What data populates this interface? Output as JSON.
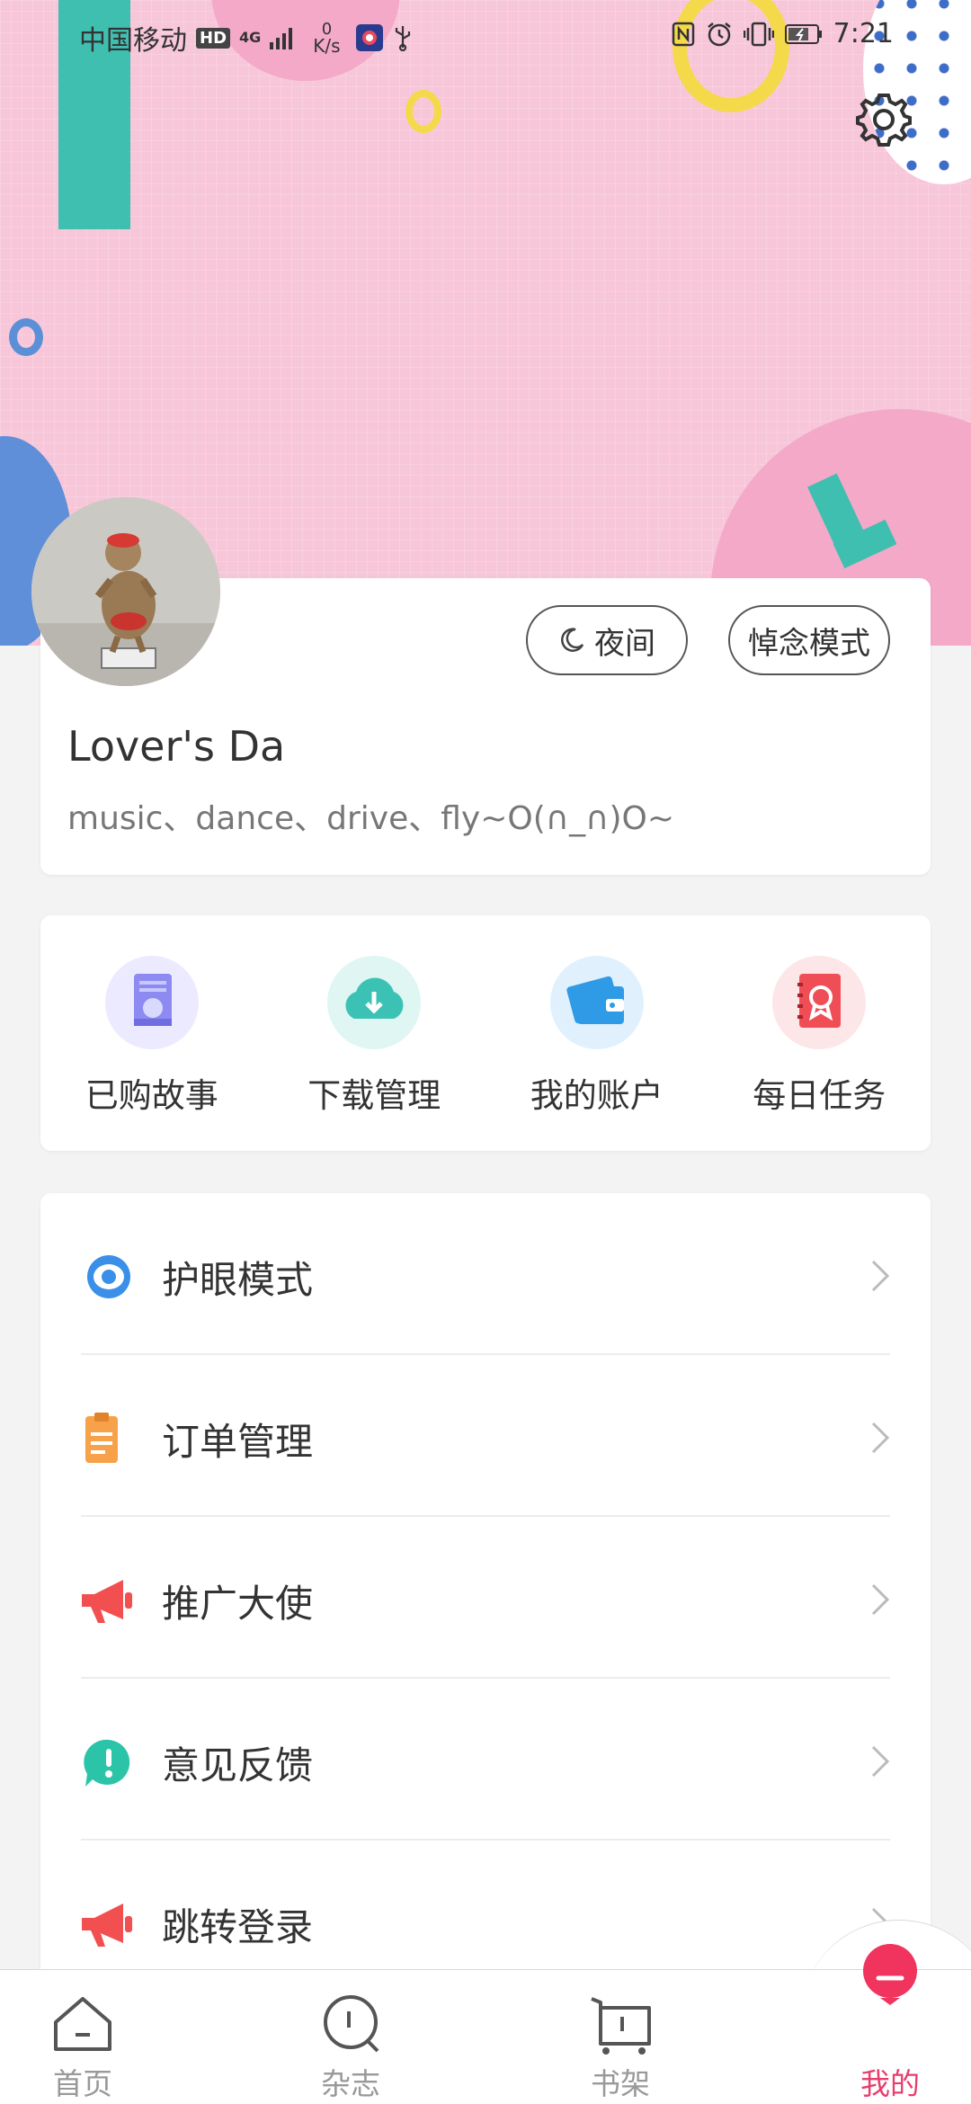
{
  "status_bar": {
    "carrier": "中国移动",
    "hd": "HD",
    "net_type": "4G",
    "speed_value": "0",
    "speed_unit": "K/s",
    "time": "7:21"
  },
  "profile": {
    "night_mode_label": "夜间",
    "mourning_mode_label": "悼念模式",
    "username": "Lover's Da",
    "bio": "music、dance、drive、fly~O(∩_∩)O~"
  },
  "quick_actions": [
    {
      "label": "已购故事",
      "icon": "purchased-book-icon",
      "color": "#8d8bf2"
    },
    {
      "label": "下载管理",
      "icon": "cloud-download-icon",
      "color": "#3cc2b5"
    },
    {
      "label": "我的账户",
      "icon": "wallet-icon",
      "color": "#2f9be6"
    },
    {
      "label": "每日任务",
      "icon": "daily-task-icon",
      "color": "#f04e57"
    }
  ],
  "menu": [
    {
      "label": "护眼模式",
      "icon": "eye-icon",
      "color": "#3a8fe8"
    },
    {
      "label": "订单管理",
      "icon": "clipboard-icon",
      "color": "#f7a24b"
    },
    {
      "label": "推广大使",
      "icon": "megaphone-icon",
      "color": "#f25050"
    },
    {
      "label": "意见反馈",
      "icon": "feedback-icon",
      "color": "#2cc4a8"
    },
    {
      "label": "跳转登录",
      "icon": "megaphone-icon",
      "color": "#f25050"
    }
  ],
  "bottom_nav": [
    {
      "label": "首页",
      "icon": "home-icon"
    },
    {
      "label": "杂志",
      "icon": "magazine-icon"
    },
    {
      "label": "书架",
      "icon": "bookshelf-icon"
    },
    {
      "label": "我的",
      "icon": "profile-icon",
      "active": true
    }
  ],
  "colors": {
    "accent": "#e83e6e",
    "banner_pink": "#f7c6d8"
  }
}
